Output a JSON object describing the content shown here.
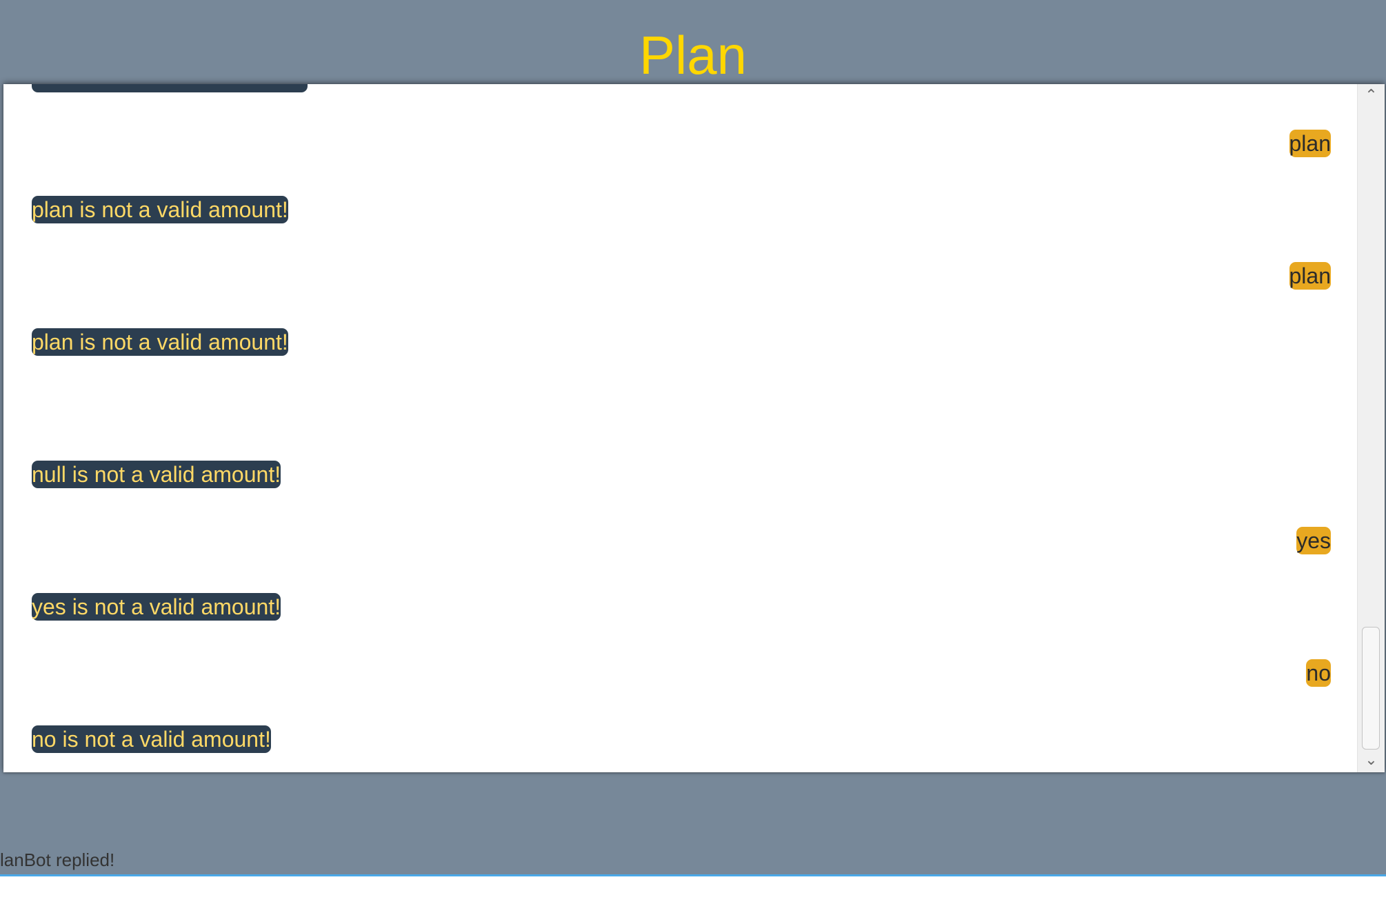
{
  "header": {
    "title": "Plan"
  },
  "chat": {
    "messages": [
      {
        "sender": "bot",
        "text": ""
      },
      {
        "sender": "user",
        "text": "plan"
      },
      {
        "sender": "bot",
        "text": "plan is not a valid amount!"
      },
      {
        "sender": "user",
        "text": "plan"
      },
      {
        "sender": "bot",
        "text": "plan is not a valid amount!"
      },
      {
        "sender": "user",
        "text": ""
      },
      {
        "sender": "bot",
        "text": "null is not a valid amount!"
      },
      {
        "sender": "user",
        "text": "yes"
      },
      {
        "sender": "bot",
        "text": "yes is not a valid amount!"
      },
      {
        "sender": "user",
        "text": "no"
      },
      {
        "sender": "bot",
        "text": "no is not a valid amount!"
      }
    ]
  },
  "status": {
    "text": "lanBot replied!"
  },
  "input": {
    "value": ""
  },
  "colors": {
    "page_background": "#778899",
    "title": "#FFD700",
    "bot_bubble": "#2C3E50",
    "bot_text": "#FFD966",
    "user_bubble": "#E8A820",
    "user_text": "#2b2b2b",
    "input_border": "#4aa8e8"
  },
  "icons": {
    "scroll_up": "chevron-up-icon",
    "scroll_down": "chevron-down-icon"
  }
}
